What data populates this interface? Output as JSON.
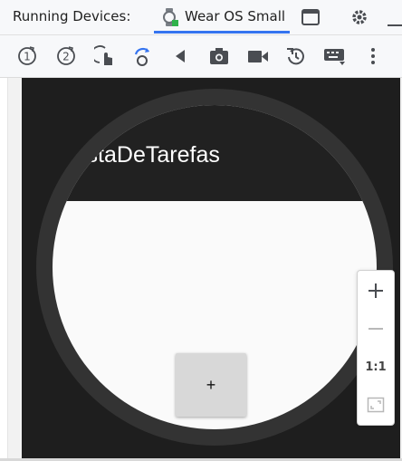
{
  "titlebar": {
    "label": "Running Devices:",
    "device_tab": {
      "name": "Wear OS Small",
      "icon": "watch-icon"
    },
    "icons": [
      "window-icon",
      "gear-icon",
      "minimize-icon"
    ]
  },
  "toolbar": {
    "icons": [
      "power-1-icon",
      "power-2-icon",
      "touch-icon",
      "rotate-icon",
      "back-icon",
      "camera-icon",
      "video-icon",
      "reset-icon",
      "keyboard-icon",
      "more-icon"
    ]
  },
  "app": {
    "title": "istaDeTarefas",
    "fab_label": "+"
  },
  "zoom": {
    "plus": "+",
    "minus": "−",
    "one_to_one": "1:1",
    "fit_icon": "fit-screen-icon"
  },
  "colors": {
    "accent": "#3574f0",
    "screen_bg": "#1e1e1e",
    "app_header": "#212121",
    "app_body": "#fafafa"
  }
}
